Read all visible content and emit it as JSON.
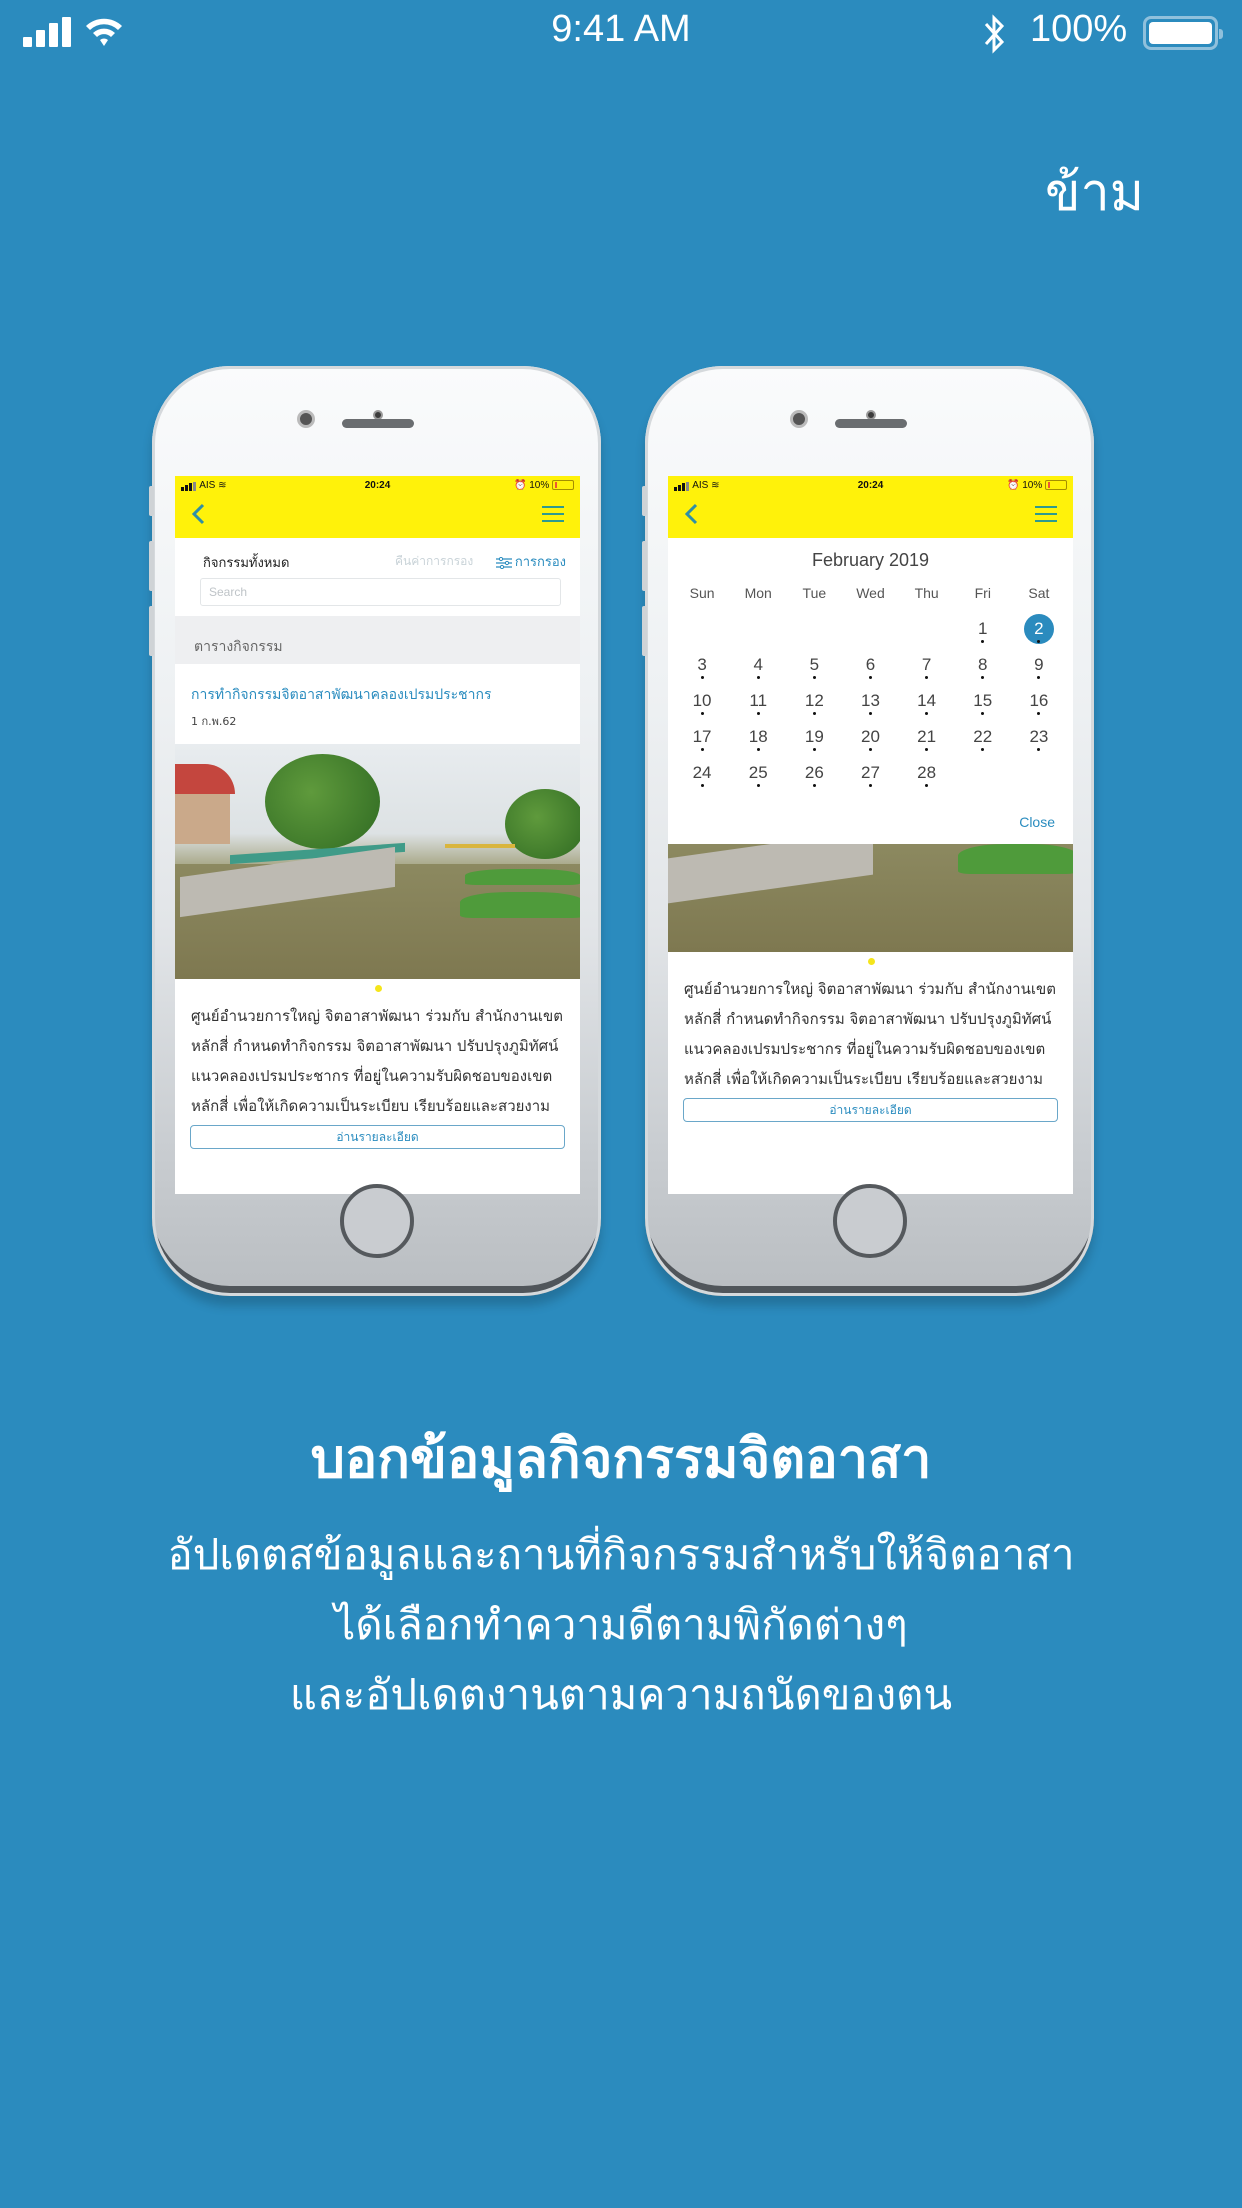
{
  "status_bar": {
    "time": "9:41 AM",
    "battery_percent": "100%",
    "battery_level": 1.0,
    "icons": [
      "signal-icon",
      "wifi-icon",
      "bluetooth-icon",
      "battery-icon"
    ]
  },
  "skip_label": "ข้าม",
  "colors": {
    "background": "#2B8BBE",
    "app_header": "#FFF20A",
    "accent": "#2A8CBF",
    "pager_dot": "#F5E51B"
  },
  "phone_status": {
    "carrier": "AIS",
    "time": "20:24",
    "battery_percent": "10%"
  },
  "activity_list_screen": {
    "filter_title": "กิจกรรมทั้งหมด",
    "reset_filter_label": "คืนค่าการกรอง",
    "filter_label": "การกรอง",
    "search_placeholder": "Search",
    "section_title": "ตารางกิจกรรม",
    "event": {
      "title": "การทำกิจกรรมจิตอาสาพัฒนาคลองเปรมประชากร",
      "date": "1 ก.พ.62",
      "description": "ศูนย์อำนวยการใหญ่ จิตอาสาพัฒนา ร่วมกับ สำนักงานเขตหลักสี่  กำหนดทำกิจกรรม จิตอาสาพัฒนา ปรับปรุงภูมิทัศน์ แนวคลองเปรมประชากร ที่อยู่ในความรับผิดชอบของเขต หลักสี่  เพื่อให้เกิดความเป็นระเบียบ เรียบร้อยและสวยงาม",
      "read_more_label": "อ่านรายละเอียด"
    }
  },
  "calendar_screen": {
    "month_title": "February 2019",
    "weekdays": [
      "Sun",
      "Mon",
      "Tue",
      "Wed",
      "Thu",
      "Fri",
      "Sat"
    ],
    "leading_blanks": 5,
    "days": [
      "1",
      "2",
      "3",
      "4",
      "5",
      "6",
      "7",
      "8",
      "9",
      "10",
      "11",
      "12",
      "13",
      "14",
      "15",
      "16",
      "17",
      "18",
      "19",
      "20",
      "21",
      "22",
      "23",
      "24",
      "25",
      "26",
      "27",
      "28"
    ],
    "selected_day": "2",
    "close_label": "Close",
    "description": "ศูนย์อำนวยการใหญ่ จิตอาสาพัฒนา ร่วมกับ สำนักงานเขตหลักสี่  กำหนดทำกิจกรรม จิตอาสาพัฒนา ปรับปรุงภูมิทัศน์ แนวคลองเปรมประชากร ที่อยู่ในความรับผิดชอบของเขต หลักสี่  เพื่อให้เกิดความเป็นระเบียบ เรียบร้อยและสวยงาม",
    "read_more_label": "อ่านรายละเอียด"
  },
  "onboarding": {
    "title": "บอกข้อมูลกิจกรรมจิตอาสา",
    "description_lines": [
      "อัปเดตสข้อมูลและถานที่กิจกรรมสำหรับให้จิตอาสา",
      "ได้เลือกทำความดีตามพิกัดต่างๆ",
      "และอัปเดตงานตามความถนัดของตน"
    ]
  }
}
